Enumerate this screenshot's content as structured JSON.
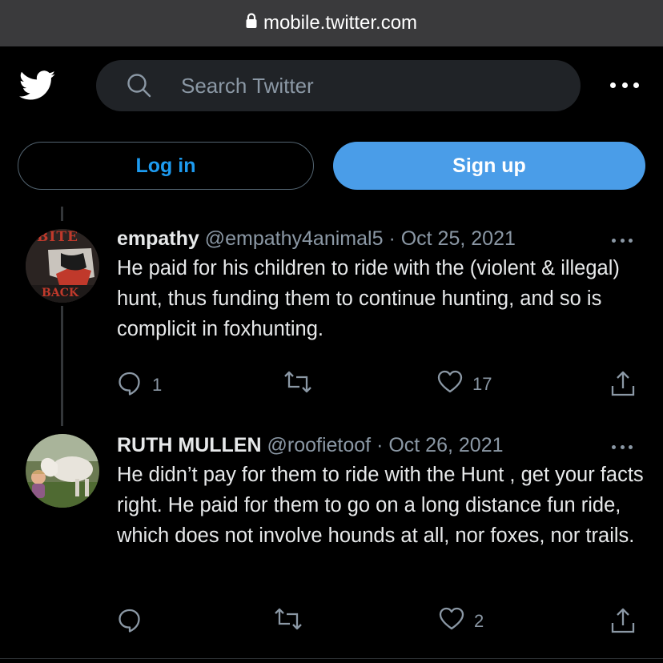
{
  "browser": {
    "url": "mobile.twitter.com"
  },
  "header": {
    "search_placeholder": "Search Twitter",
    "login_label": "Log in",
    "signup_label": "Sign up"
  },
  "tweets": [
    {
      "display_name": "empathy",
      "handle": "@empathy4animal5",
      "separator": "·",
      "date": "Oct 25, 2021",
      "text": "He paid for his children to ride with the (violent & illegal) hunt, thus funding them to continue hunting, and so is complicit in foxhunting.",
      "avatar_text_top": "BITE",
      "avatar_text_bottom": "BACK",
      "reply_count": "1",
      "retweet_count": "",
      "like_count": "17"
    },
    {
      "display_name": "RUTH MULLEN",
      "handle": "@roofietoof",
      "separator": "·",
      "date": "Oct 26, 2021",
      "text": "He didn’t pay for them to ride with the Hunt , get your facts right. He paid for them to go on a long distance fun ride, which does not involve hounds at all, nor foxes, nor trails.",
      "reply_count": "",
      "retweet_count": "",
      "like_count": "2"
    }
  ],
  "colors": {
    "accent": "#1d9bf0",
    "signup_bg": "#4a9de8",
    "muted": "#8b98a5",
    "background": "#000000"
  },
  "icons": [
    "lock-icon",
    "twitter-bird-icon",
    "search-icon",
    "more-icon",
    "reply-icon",
    "retweet-icon",
    "like-icon",
    "share-icon"
  ]
}
